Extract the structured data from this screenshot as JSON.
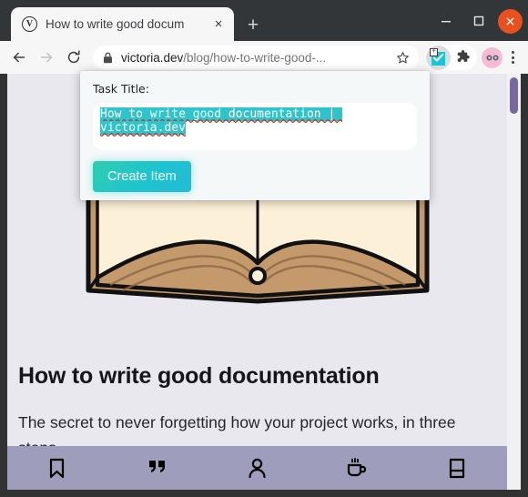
{
  "browser": {
    "tab": {
      "title": "How to write good docum",
      "favicon_letter": "V",
      "favicon_name": "victoria-dev-favicon",
      "close_label": "×"
    },
    "new_tab_label": "+",
    "window_controls": {
      "minimize": "minimize",
      "maximize": "maximize",
      "close": "close"
    },
    "toolbar": {
      "back": "back",
      "forward": "forward",
      "reload": "reload",
      "url_host": "victoria.dev",
      "url_path": "/blog/how-to-write-good-...",
      "bookmark": "bookmark-star",
      "extension_active": "task-creator-extension",
      "extension_puzzle": "extensions",
      "profile": "profile-avatar",
      "menu": "chrome-menu"
    }
  },
  "popup": {
    "label": "Task Title:",
    "input_value": "How to write good documentation | victoria.dev",
    "button_label": "Create Item"
  },
  "page": {
    "heading": "How to write good documentation",
    "subtitle": "The secret to never forgetting how your project works, in three steps.",
    "hero_alt": "open-book-illustration",
    "nav": [
      {
        "name": "bookmark",
        "icon": "bookmark-icon"
      },
      {
        "name": "quotes",
        "icon": "quote-icon"
      },
      {
        "name": "about",
        "icon": "person-icon"
      },
      {
        "name": "support",
        "icon": "coffee-cup-icon"
      },
      {
        "name": "book",
        "icon": "book-icon"
      }
    ]
  },
  "colors": {
    "accent_teal": "#2ec4cc",
    "nav_bar": "#9e9dbb",
    "page_bg": "#e9e8ee",
    "scrollbar_thumb": "#77699b",
    "close_button": "#e9501f"
  }
}
